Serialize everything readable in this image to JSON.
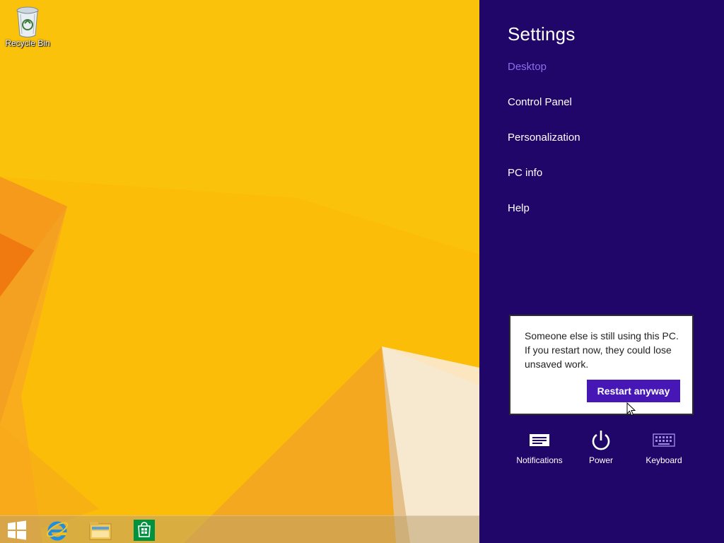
{
  "desktop": {
    "recycle_bin_label": "Recycle Bin"
  },
  "taskbar": {
    "items": [
      {
        "icon": "windows-start-icon"
      },
      {
        "icon": "internet-explorer-icon"
      },
      {
        "icon": "file-explorer-icon"
      },
      {
        "icon": "store-icon"
      }
    ]
  },
  "settings": {
    "title": "Settings",
    "context": "Desktop",
    "links": [
      "Control Panel",
      "Personalization",
      "PC info",
      "Help"
    ]
  },
  "flyout": {
    "message": "Someone else is still using this PC. If you restart now, they could lose unsaved work.",
    "button_label": "Restart anyway"
  },
  "quick_icons": {
    "notifications": "Notifications",
    "power": "Power",
    "keyboard": "Keyboard"
  },
  "colors": {
    "wallpaper": "#fbbd08",
    "charm_bg": "#200669",
    "accent": "#4617b4",
    "context_text": "#8a6fe8"
  }
}
